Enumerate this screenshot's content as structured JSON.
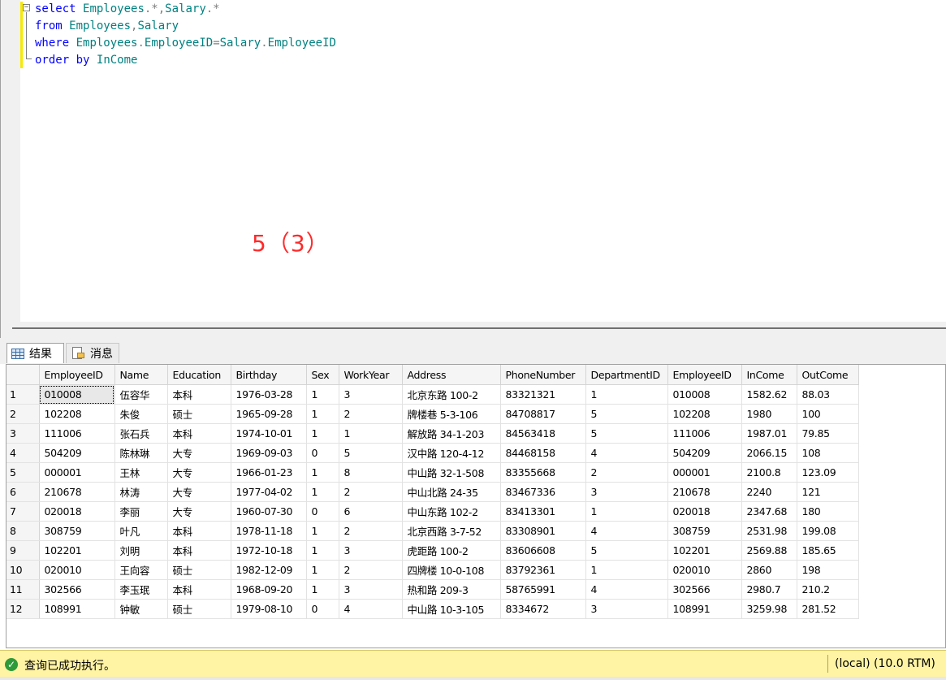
{
  "editor": {
    "lines": [
      [
        {
          "t": "select",
          "c": "kw"
        },
        {
          "t": " ",
          "c": ""
        },
        {
          "t": "Employees",
          "c": "ident"
        },
        {
          "t": ".*,",
          "c": "op"
        },
        {
          "t": "Salary",
          "c": "ident"
        },
        {
          "t": ".*",
          "c": "op"
        }
      ],
      [
        {
          "t": "from",
          "c": "kw"
        },
        {
          "t": " ",
          "c": ""
        },
        {
          "t": "Employees",
          "c": "ident"
        },
        {
          "t": ",",
          "c": "op"
        },
        {
          "t": "Salary",
          "c": "ident"
        }
      ],
      [
        {
          "t": "where",
          "c": "kw"
        },
        {
          "t": " ",
          "c": ""
        },
        {
          "t": "Employees",
          "c": "ident"
        },
        {
          "t": ".",
          "c": "op"
        },
        {
          "t": "EmployeeID",
          "c": "ident"
        },
        {
          "t": "=",
          "c": "op"
        },
        {
          "t": "Salary",
          "c": "ident"
        },
        {
          "t": ".",
          "c": "op"
        },
        {
          "t": "EmployeeID",
          "c": "ident"
        }
      ],
      [
        {
          "t": "order",
          "c": "kw"
        },
        {
          "t": " ",
          "c": ""
        },
        {
          "t": "by",
          "c": "kw"
        },
        {
          "t": " ",
          "c": ""
        },
        {
          "t": "InCome",
          "c": "ident"
        }
      ]
    ],
    "annotation": "5（3）",
    "fold_symbol": "−"
  },
  "tabs": {
    "results_label": "结果",
    "messages_label": "消息"
  },
  "grid": {
    "columns": [
      "EmployeeID",
      "Name",
      "Education",
      "Birthday",
      "Sex",
      "WorkYear",
      "Address",
      "PhoneNumber",
      "DepartmentID",
      "EmployeeID",
      "InCome",
      "OutCome"
    ],
    "rows": [
      [
        "1",
        "010008",
        "伍容华",
        "本科",
        "1976-03-28",
        "1",
        "3",
        "北京东路 100-2",
        "83321321",
        "1",
        "010008",
        "1582.62",
        "88.03"
      ],
      [
        "2",
        "102208",
        "朱俊",
        "硕士",
        "1965-09-28",
        "1",
        "2",
        "牌楼巷 5-3-106",
        "84708817",
        "5",
        "102208",
        "1980",
        "100"
      ],
      [
        "3",
        "111006",
        "张石兵",
        "本科",
        "1974-10-01",
        "1",
        "1",
        "解放路 34-1-203",
        "84563418",
        "5",
        "111006",
        "1987.01",
        "79.85"
      ],
      [
        "4",
        "504209",
        "陈林琳",
        "大专",
        "1969-09-03",
        "0",
        "5",
        "汉中路 120-4-12",
        "84468158",
        "4",
        "504209",
        "2066.15",
        "108"
      ],
      [
        "5",
        "000001",
        "王林",
        "大专",
        "1966-01-23",
        "1",
        "8",
        "中山路 32-1-508",
        "83355668",
        "2",
        "000001",
        "2100.8",
        "123.09"
      ],
      [
        "6",
        "210678",
        "林涛",
        "大专",
        "1977-04-02",
        "1",
        "2",
        "中山北路 24-35",
        "83467336",
        "3",
        "210678",
        "2240",
        "121"
      ],
      [
        "7",
        "020018",
        "李丽",
        "大专",
        "1960-07-30",
        "0",
        "6",
        "中山东路 102-2",
        "83413301",
        "1",
        "020018",
        "2347.68",
        "180"
      ],
      [
        "8",
        "308759",
        "叶凡",
        "本科",
        "1978-11-18",
        "1",
        "2",
        "北京西路 3-7-52",
        "83308901",
        "4",
        "308759",
        "2531.98",
        "199.08"
      ],
      [
        "9",
        "102201",
        "刘明",
        "本科",
        "1972-10-18",
        "1",
        "3",
        "虎距路 100-2",
        "83606608",
        "5",
        "102201",
        "2569.88",
        "185.65"
      ],
      [
        "10",
        "020010",
        "王向容",
        "硕士",
        "1982-12-09",
        "1",
        "2",
        "四牌楼 10-0-108",
        "83792361",
        "1",
        "020010",
        "2860",
        "198"
      ],
      [
        "11",
        "302566",
        "李玉珉",
        "本科",
        "1968-09-20",
        "1",
        "3",
        "热和路 209-3",
        "58765991",
        "4",
        "302566",
        "2980.7",
        "210.2"
      ],
      [
        "12",
        "108991",
        "钟敏",
        "硕士",
        "1979-08-10",
        "0",
        "4",
        "中山路 10-3-105",
        "8334672",
        "3",
        "108991",
        "3259.98",
        "281.52"
      ]
    ]
  },
  "status": {
    "message": "查询已成功执行。",
    "server": "(local) (10.0 RTM)",
    "ok_glyph": "✓"
  }
}
